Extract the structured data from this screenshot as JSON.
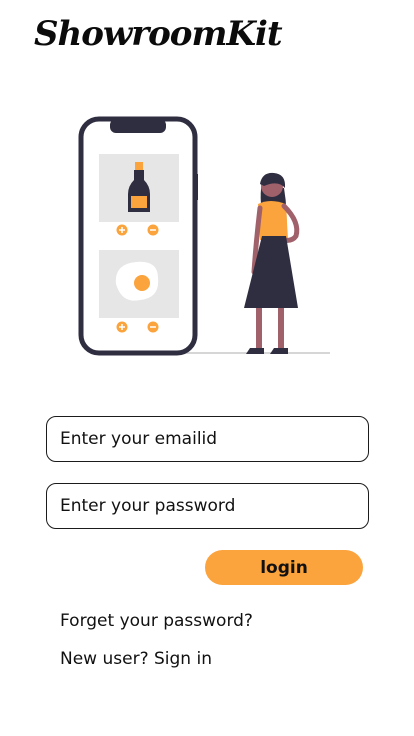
{
  "app": {
    "title": "ShowroomKit"
  },
  "form": {
    "email_placeholder": "Enter your emailid",
    "password_placeholder": "Enter your password",
    "login_label": "login",
    "forgot_label": "Forget your password?",
    "signup_label": "New user? Sign in"
  },
  "illustration": {
    "description_icons": [
      "phone-icon",
      "bottle-icon",
      "fried-egg-icon",
      "plus-icon",
      "minus-icon",
      "woman-icon"
    ]
  },
  "colors": {
    "accent": "#fba33c",
    "dark": "#2f2e41",
    "panel": "#e6e6e6",
    "text": "#111111"
  }
}
